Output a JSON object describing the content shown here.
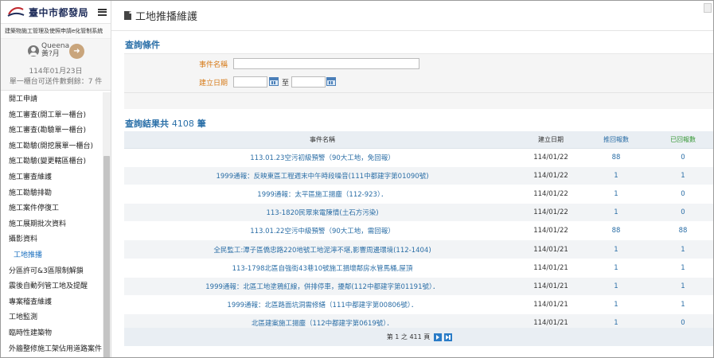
{
  "sidebar": {
    "brand": "臺中市都發局",
    "system_name": "建築物施工管理及使照申請e化管制系統",
    "user": {
      "name": "Queena",
      "role": "黃?月",
      "date": "114年01月23日",
      "pending_label": "單一櫃台可送件數剩餘：7 件"
    },
    "menu": [
      {
        "label": "開工申請",
        "active": false
      },
      {
        "label": "施工審查(開工單一櫃台)",
        "active": false
      },
      {
        "label": "施工審查(勘驗單一櫃台)",
        "active": false
      },
      {
        "label": "施工勘驗(開挖展單一櫃台)",
        "active": false
      },
      {
        "label": "施工勘驗(變更轄區櫃台)",
        "active": false
      },
      {
        "label": "施工審查維護",
        "active": false
      },
      {
        "label": "施工勘驗排勘",
        "active": false
      },
      {
        "label": "施工案件停復工",
        "active": false
      },
      {
        "label": "施工展期批次資料",
        "active": false
      },
      {
        "label": "攝影資料",
        "active": false
      },
      {
        "label": "工地推播",
        "active": true
      },
      {
        "label": "分區許可&3區限制解鎖",
        "active": false
      },
      {
        "label": "震後自動列管工地及提醒",
        "active": false
      },
      {
        "label": "專案稽查維護",
        "active": false
      },
      {
        "label": "工地監測",
        "active": false
      },
      {
        "label": "臨時性建築物",
        "active": false
      },
      {
        "label": "外牆整修施工架佔用道路案件",
        "active": false
      }
    ]
  },
  "main": {
    "title": "工地推播維護",
    "query": {
      "section_title": "查詢條件",
      "event_label": "事件名稱",
      "date_label": "建立日期",
      "date_separator": "至",
      "event_value": "",
      "date_from": "",
      "date_to": ""
    },
    "results": {
      "title_prefix": "查詢結果共",
      "count": "4108",
      "title_suffix": "筆",
      "columns": [
        "事件名稱",
        "建立日期",
        "推回報數",
        "已回報數"
      ],
      "rows": [
        {
          "name": "113.01.23空污初級預警（90大工地，免回報）",
          "date": "114/01/22",
          "pushed": "88",
          "replied": "0"
        },
        {
          "name": "1999通報：反映東區工程週末中午時段噪音(111中都建字第01090號)",
          "date": "114/01/22",
          "pushed": "1",
          "replied": "1"
        },
        {
          "name": "1999通報：太平區施工揚塵（112-923）．",
          "date": "114/01/22",
          "pushed": "1",
          "replied": "0"
        },
        {
          "name": "113-1820民眾來電陳情(土石方污染)",
          "date": "114/01/22",
          "pushed": "1",
          "replied": "0"
        },
        {
          "name": "113.01.22空污中級預警（90大工地，需回報）",
          "date": "114/01/22",
          "pushed": "88",
          "replied": "88"
        },
        {
          "name": "全民監工:潭子區僑忠路220地號工地泥濘不堪,影響周邊環境(112-1404)",
          "date": "114/01/21",
          "pushed": "1",
          "replied": "1"
        },
        {
          "name": "113-1798北區自強街43巷10號施工損壞鄰房水管馬桶,屋頂",
          "date": "114/01/21",
          "pushed": "1",
          "replied": "1"
        },
        {
          "name": "1999通報：北區工地塗鴉紅線，併排停車，擾鄰(112中都建字第01191號）．",
          "date": "114/01/21",
          "pushed": "1",
          "replied": "1"
        },
        {
          "name": "1999通報：北區路面坑洞需修繕（111中都建字第00806號）．",
          "date": "114/01/21",
          "pushed": "1",
          "replied": "1"
        },
        {
          "name": "北區建案施工揚塵（112中都建字第0619號）．",
          "date": "114/01/21",
          "pushed": "1",
          "replied": "0"
        }
      ],
      "pager": "第 1 之 411 頁"
    }
  }
}
